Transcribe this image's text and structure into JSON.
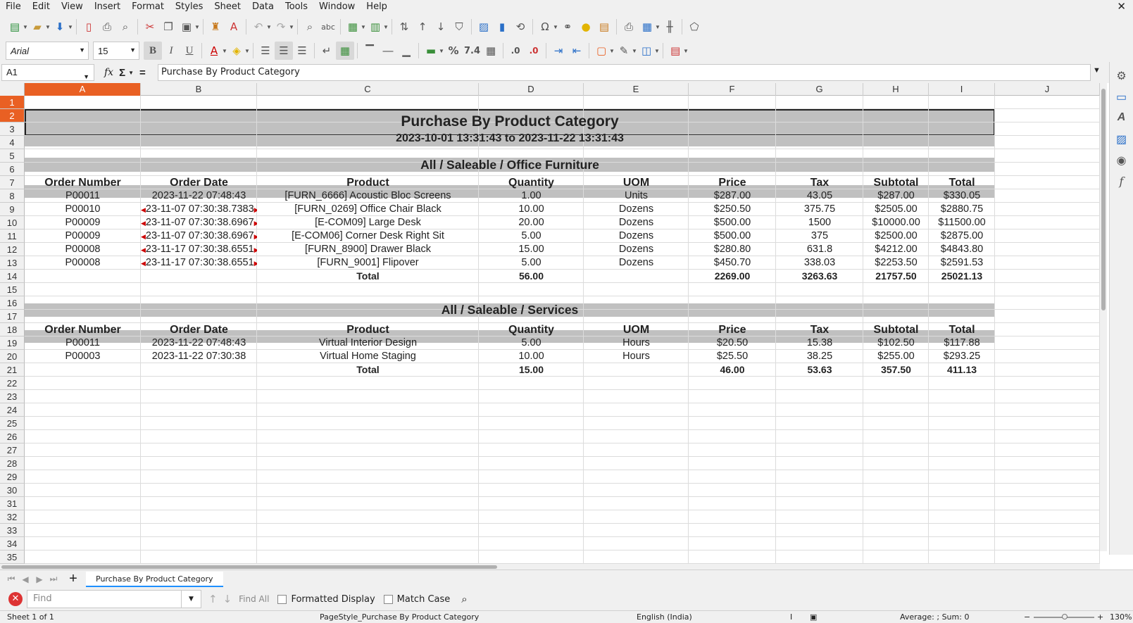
{
  "menu": [
    "File",
    "Edit",
    "View",
    "Insert",
    "Format",
    "Styles",
    "Sheet",
    "Data",
    "Tools",
    "Window",
    "Help"
  ],
  "close_glyph": "✕",
  "font": {
    "name": "Arial",
    "size": "15"
  },
  "formula_bar": {
    "cell_ref": "A1",
    "fx": "fx",
    "sigma": "Σ",
    "equals": "=",
    "content": "Purchase By Product Category"
  },
  "columns": [
    "A",
    "B",
    "C",
    "D",
    "E",
    "F",
    "G",
    "H",
    "I",
    "J"
  ],
  "rows": [
    "1",
    "2",
    "3",
    "4",
    "5",
    "6",
    "7",
    "8",
    "9",
    "10",
    "11",
    "12",
    "13",
    "14",
    "15",
    "16",
    "17",
    "18",
    "19",
    "20",
    "21",
    "22",
    "23",
    "24",
    "25",
    "26",
    "27",
    "28",
    "29",
    "30",
    "31",
    "32",
    "33",
    "34",
    "35"
  ],
  "sheet": {
    "title": "Purchase By Product Category",
    "date_range": "2023-10-01 13:31:43 to 2023-11-22 13:31:43",
    "headers": [
      "Order Number",
      "Order Date",
      "Product",
      "Quantity",
      "UOM",
      "Price",
      "Tax",
      "Subtotal",
      "Total"
    ],
    "sections": [
      {
        "name": "All / Saleable / Office Furniture",
        "rows": [
          [
            "P00011",
            "2023-11-22 07:48:43",
            "[FURN_6666] Acoustic Bloc Screens",
            "1.00",
            "Units",
            "$287.00",
            "43.05",
            "$287.00",
            "$330.05"
          ],
          [
            "P00010",
            "23-11-07 07:30:38.7383",
            "[FURN_0269] Office Chair Black",
            "10.00",
            "Dozens",
            "$250.50",
            "375.75",
            "$2505.00",
            "$2880.75"
          ],
          [
            "P00009",
            "23-11-07 07:30:38.6967",
            "[E-COM09] Large Desk",
            "20.00",
            "Dozens",
            "$500.00",
            "1500",
            "$10000.00",
            "$11500.00"
          ],
          [
            "P00009",
            "23-11-07 07:30:38.6967",
            "[E-COM06] Corner Desk Right Sit",
            "5.00",
            "Dozens",
            "$500.00",
            "375",
            "$2500.00",
            "$2875.00"
          ],
          [
            "P00008",
            "23-11-17 07:30:38.6551",
            "[FURN_8900] Drawer Black",
            "15.00",
            "Dozens",
            "$280.80",
            "631.8",
            "$4212.00",
            "$4843.80"
          ],
          [
            "P00008",
            "23-11-17 07:30:38.6551",
            "[FURN_9001] Flipover",
            "5.00",
            "Dozens",
            "$450.70",
            "338.03",
            "$2253.50",
            "$2591.53"
          ]
        ],
        "total": {
          "label": "Total",
          "quantity": "56.00",
          "price": "2269.00",
          "tax": "3263.63",
          "subtotal": "21757.50",
          "total": "25021.13"
        }
      },
      {
        "name": "All / Saleable / Services",
        "rows": [
          [
            "P00011",
            "2023-11-22 07:48:43",
            "Virtual Interior Design",
            "5.00",
            "Hours",
            "$20.50",
            "15.38",
            "$102.50",
            "$117.88"
          ],
          [
            "P00003",
            "2023-11-22 07:30:38",
            "Virtual Home Staging",
            "10.00",
            "Hours",
            "$25.50",
            "38.25",
            "$255.00",
            "$293.25"
          ]
        ],
        "total": {
          "label": "Total",
          "quantity": "15.00",
          "price": "46.00",
          "tax": "53.63",
          "subtotal": "357.50",
          "total": "411.13"
        }
      }
    ]
  },
  "tabs": {
    "active": "Purchase By Product Category",
    "add": "+"
  },
  "find": {
    "placeholder": "Find",
    "find_all": "Find All",
    "formatted_display": "Formatted Display",
    "match_case": "Match Case"
  },
  "status": {
    "sheet": "Sheet 1 of 1",
    "page_style": "PageStyle_Purchase By Product Category",
    "language": "English (India)",
    "summary": "Average: ; Sum: 0",
    "zoom": "130%"
  },
  "accent_color": "#e96023"
}
